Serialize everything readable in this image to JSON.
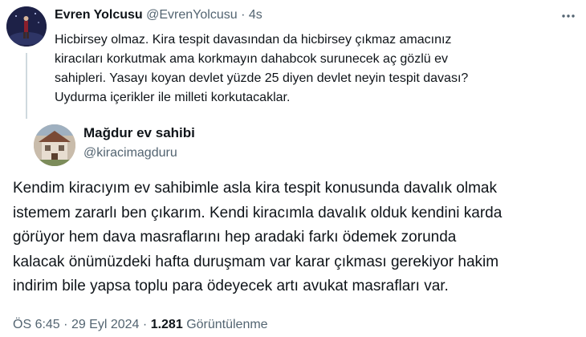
{
  "reply_tweet": {
    "author_name": "Evren Yolcusu",
    "author_handle": "@EvrenYolcusu",
    "separator": "·",
    "time": "4s",
    "more_icon": "more-horizontal-icon",
    "text_lines": [
      "Hicbirsey olmaz. Kira tespit davasından da hicbirsey çıkmaz amacınız",
      "kiracıları korkutmak ama korkmayın dahabcok surunecek aç gözlü ev",
      "sahipleri. Yasayı koyan devlet yüzde 25 diyen devlet neyin tespit davası?",
      "Uydurma içerikler ile milleti korkutacaklar."
    ]
  },
  "main_tweet": {
    "author_name": "Mağdur ev sahibi",
    "author_handle": "@kiracimagduru",
    "text_lines": [
      "Kendim kiracıyım ev sahibimle asla kira tespit konusunda davalık olmak",
      "istemem zararlı ben çıkarım. Kendi kiracımla davalık olduk kendini karda",
      "görüyor hem dava masraflarını hep aradaki farkı ödemek zorunda",
      "kalacak önümüzdeki hafta duruşmam var karar çıkması gerekiyor hakim",
      "indirim bile yapsa toplu para ödeyecek artı avukat masrafları var."
    ],
    "time": "ÖS 6:45",
    "separator": "·",
    "date": "29 Eyl 2024",
    "views_count": "1.281",
    "views_label": "Görüntülenme"
  },
  "colors": {
    "text_primary": "#0f1419",
    "text_secondary": "#536471",
    "thread_line": "#cfd9de",
    "background": "#ffffff"
  }
}
